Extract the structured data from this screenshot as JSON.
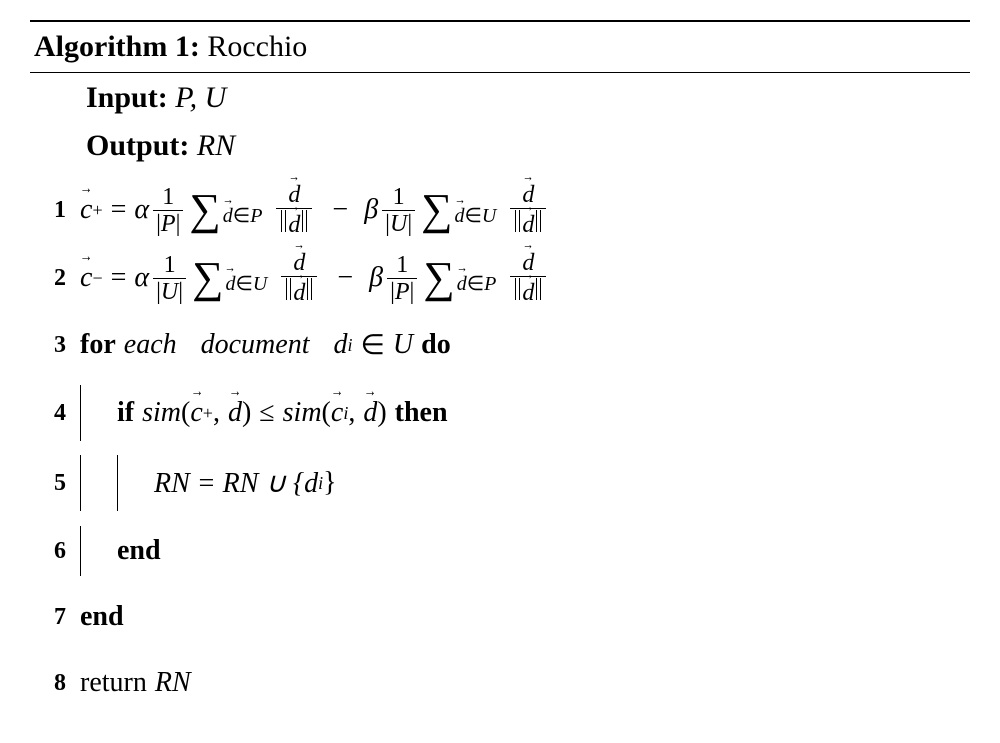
{
  "header": {
    "label": "Algorithm 1:",
    "name": "Rocchio"
  },
  "input": {
    "label": "Input:",
    "vars": "P, U"
  },
  "output": {
    "label": "Output:",
    "vars": "RN"
  },
  "greek": {
    "alpha": "α",
    "beta": "β"
  },
  "sets": {
    "P": "P",
    "U": "U"
  },
  "lines": {
    "l3": {
      "for": "for",
      "each": "each",
      "document": "document",
      "di": "d",
      "i": "i",
      "in": "∈",
      "U": "U",
      "do": "do"
    },
    "l4": {
      "if": "if",
      "sim": "sim",
      "le": "≤",
      "then": "then"
    },
    "l5": {
      "eq": "RN = RN ∪ {d",
      "i": "i",
      "close": "}"
    },
    "l6": {
      "end": "end"
    },
    "l7": {
      "end": "end"
    },
    "l8": {
      "return": "return",
      "var": "RN"
    }
  },
  "nums": [
    "1",
    "2",
    "3",
    "4",
    "5",
    "6",
    "7",
    "8"
  ]
}
